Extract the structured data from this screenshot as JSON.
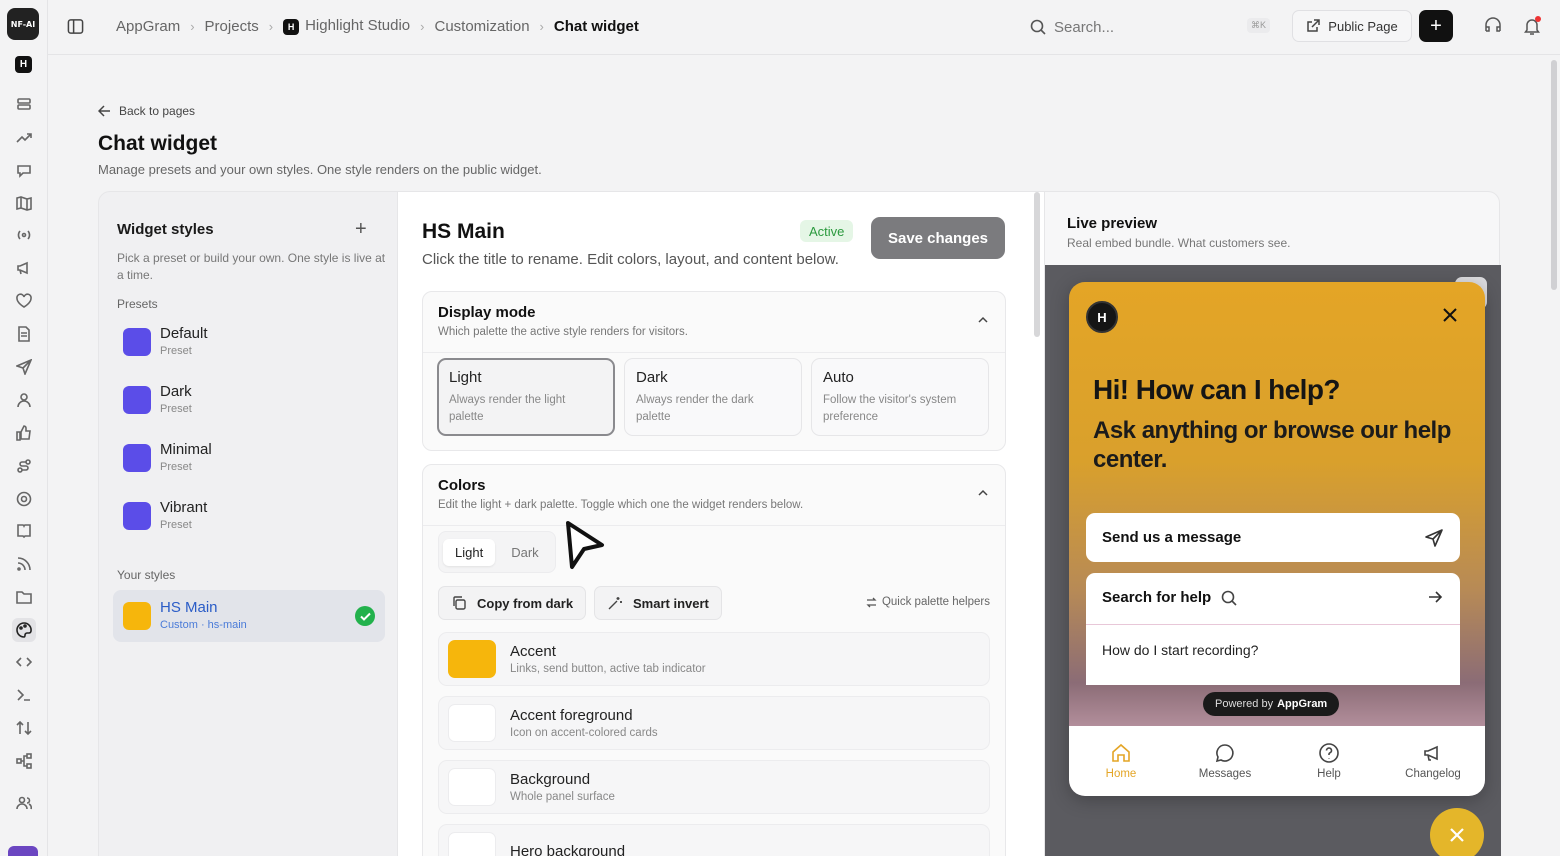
{
  "app": {
    "logo": "NF-AI",
    "workspace_badge": "H"
  },
  "rail_icons": [
    "layers-icon",
    "trend-icon",
    "chat-icon",
    "map-icon",
    "broadcast-icon",
    "megaphone-icon",
    "heart-icon",
    "doc-icon",
    "send-icon",
    "user-icon",
    "thumbs-up-icon",
    "roadmap-icon",
    "help-ring-icon",
    "book-icon",
    "rss-icon",
    "folder-icon",
    "palette-icon",
    "code-icon",
    "terminal-icon",
    "sort-icon",
    "workflow-icon",
    "team-icon"
  ],
  "breadcrumbs": {
    "items": [
      "AppGram",
      "Projects",
      "Highlight Studio",
      "Customization",
      "Chat widget"
    ],
    "project_badge": "H"
  },
  "search": {
    "placeholder": "Search...",
    "shortcut": "⌘K"
  },
  "header_actions": {
    "public_page": "Public Page",
    "plus": "+"
  },
  "page": {
    "back": "Back to pages",
    "title": "Chat widget",
    "subtitle": "Manage presets and your own styles. One style renders on the public widget."
  },
  "styles_panel": {
    "title": "Widget styles",
    "add": "+",
    "description": "Pick a preset or build your own. One style is live at a time.",
    "presets_label": "Presets",
    "presets": [
      {
        "name": "Default",
        "sub": "Preset",
        "color": "#5b4de8"
      },
      {
        "name": "Dark",
        "sub": "Preset",
        "color": "#5b4de8"
      },
      {
        "name": "Minimal",
        "sub": "Preset",
        "color": "#5b4de8"
      },
      {
        "name": "Vibrant",
        "sub": "Preset",
        "color": "#5b4de8"
      }
    ],
    "your_styles_label": "Your styles",
    "your_styles": [
      {
        "name": "HS Main",
        "sub": "Custom · hs-main",
        "color": "#f6b60c",
        "selected": true
      }
    ]
  },
  "editor": {
    "title": "HS Main",
    "status": "Active",
    "save": "Save changes",
    "description": "Click the title to rename. Edit colors, layout, and content below.",
    "display_mode": {
      "title": "Display mode",
      "desc": "Which palette the active style renders for visitors.",
      "options": [
        {
          "title": "Light",
          "desc": "Always render the light palette",
          "selected": true
        },
        {
          "title": "Dark",
          "desc": "Always render the dark palette",
          "selected": false
        },
        {
          "title": "Auto",
          "desc": "Follow the visitor's system preference",
          "selected": false
        }
      ]
    },
    "colors": {
      "title": "Colors",
      "desc": "Edit the light + dark palette. Toggle which one the widget renders below.",
      "toggle": [
        "Light",
        "Dark"
      ],
      "toggle_selected": "Light",
      "copy_from_dark": "Copy from dark",
      "smart_invert": "Smart invert",
      "helpers": "Quick palette helpers",
      "rows": [
        {
          "name": "Accent",
          "desc": "Links, send button, active tab indicator",
          "color": "#f6b60c"
        },
        {
          "name": "Accent foreground",
          "desc": "Icon on accent-colored cards",
          "color": "#ffffff"
        },
        {
          "name": "Background",
          "desc": "Whole panel surface",
          "color": "#ffffff"
        },
        {
          "name": "Hero background",
          "desc": "",
          "color": "#ffffff"
        }
      ]
    }
  },
  "preview": {
    "title": "Live preview",
    "subtitle": "Real embed bundle. What customers see.",
    "widget": {
      "logo": "H",
      "heading": "Hi! How can I help?",
      "subheading": "Ask anything or browse our help center.",
      "message_btn": "Send us a message",
      "help_search": "Search for help",
      "help_question": "How do I start recording?",
      "powered_prefix": "Powered by",
      "powered_brand": "AppGram",
      "tabs": [
        {
          "label": "Home",
          "active": true
        },
        {
          "label": "Messages",
          "active": false
        },
        {
          "label": "Help",
          "active": false
        },
        {
          "label": "Changelog",
          "active": false
        }
      ]
    }
  }
}
